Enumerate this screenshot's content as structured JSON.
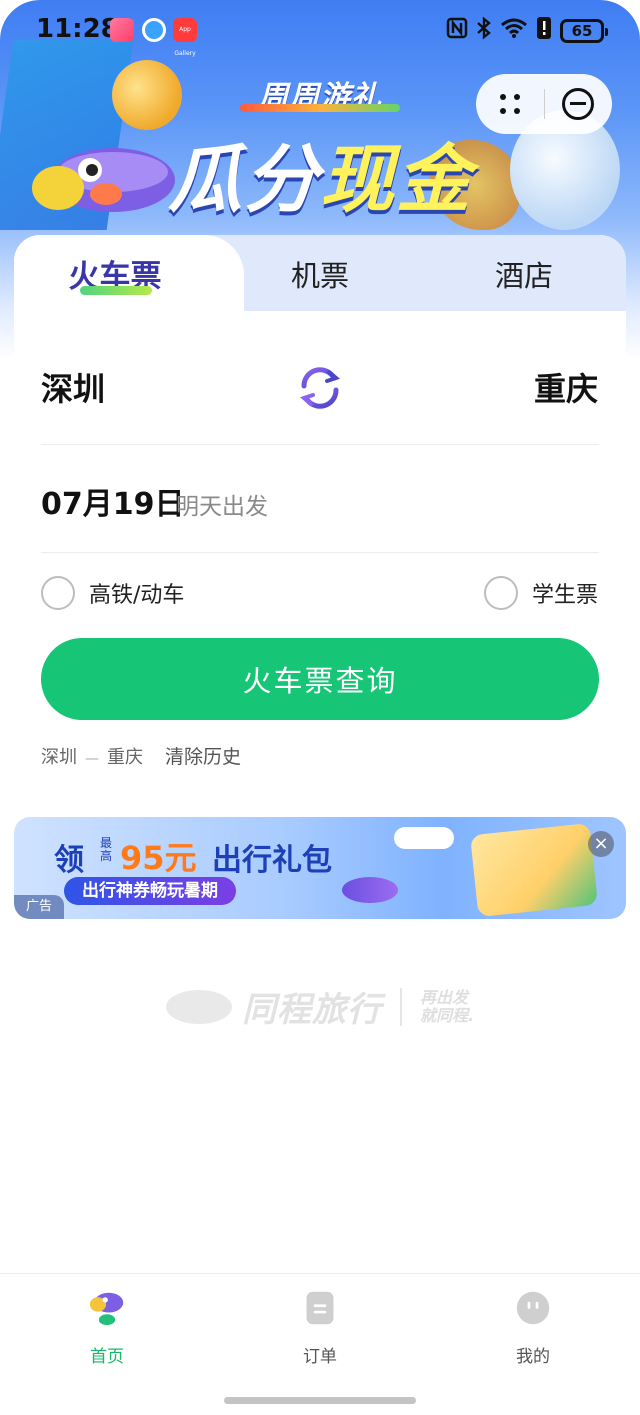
{
  "status_bar": {
    "time": "11:28",
    "battery": "65",
    "app3_text": "App Gallery",
    "icons": [
      "nfc-icon",
      "bluetooth-icon",
      "wifi-icon",
      "alert-icon",
      "battery-icon"
    ]
  },
  "banner": {
    "subtitle": "周周游礼",
    "title_part1": "瓜分",
    "title_part2": "现金"
  },
  "tabs": [
    {
      "label": "火车票",
      "active": true
    },
    {
      "label": "机票",
      "active": false
    },
    {
      "label": "酒店",
      "active": false
    }
  ],
  "route": {
    "from": "深圳",
    "to": "重庆"
  },
  "date": {
    "value": "07月19日",
    "note": "明天出发"
  },
  "options": {
    "highspeed": "高铁/动车",
    "student": "学生票"
  },
  "search_button": "火车票查询",
  "history": {
    "from": "深圳",
    "arrow": "—",
    "to": "重庆",
    "clear": "清除历史"
  },
  "ad": {
    "lead": "领",
    "tiny": "最高",
    "amount": "95元",
    "rest": "出行礼包",
    "pill": "出行神券畅玩暑期",
    "tag": "广告",
    "close": "×"
  },
  "brand": {
    "name": "同程旅行",
    "slogan_line1": "再出发",
    "slogan_line2": "就同程."
  },
  "bottom_nav": [
    {
      "label": "首页",
      "active": true
    },
    {
      "label": "订单",
      "active": false
    },
    {
      "label": "我的",
      "active": false
    }
  ],
  "colors": {
    "primary_green": "#16c575",
    "tab_active_text": "#3b36a8",
    "nav_active": "#16b86a"
  }
}
